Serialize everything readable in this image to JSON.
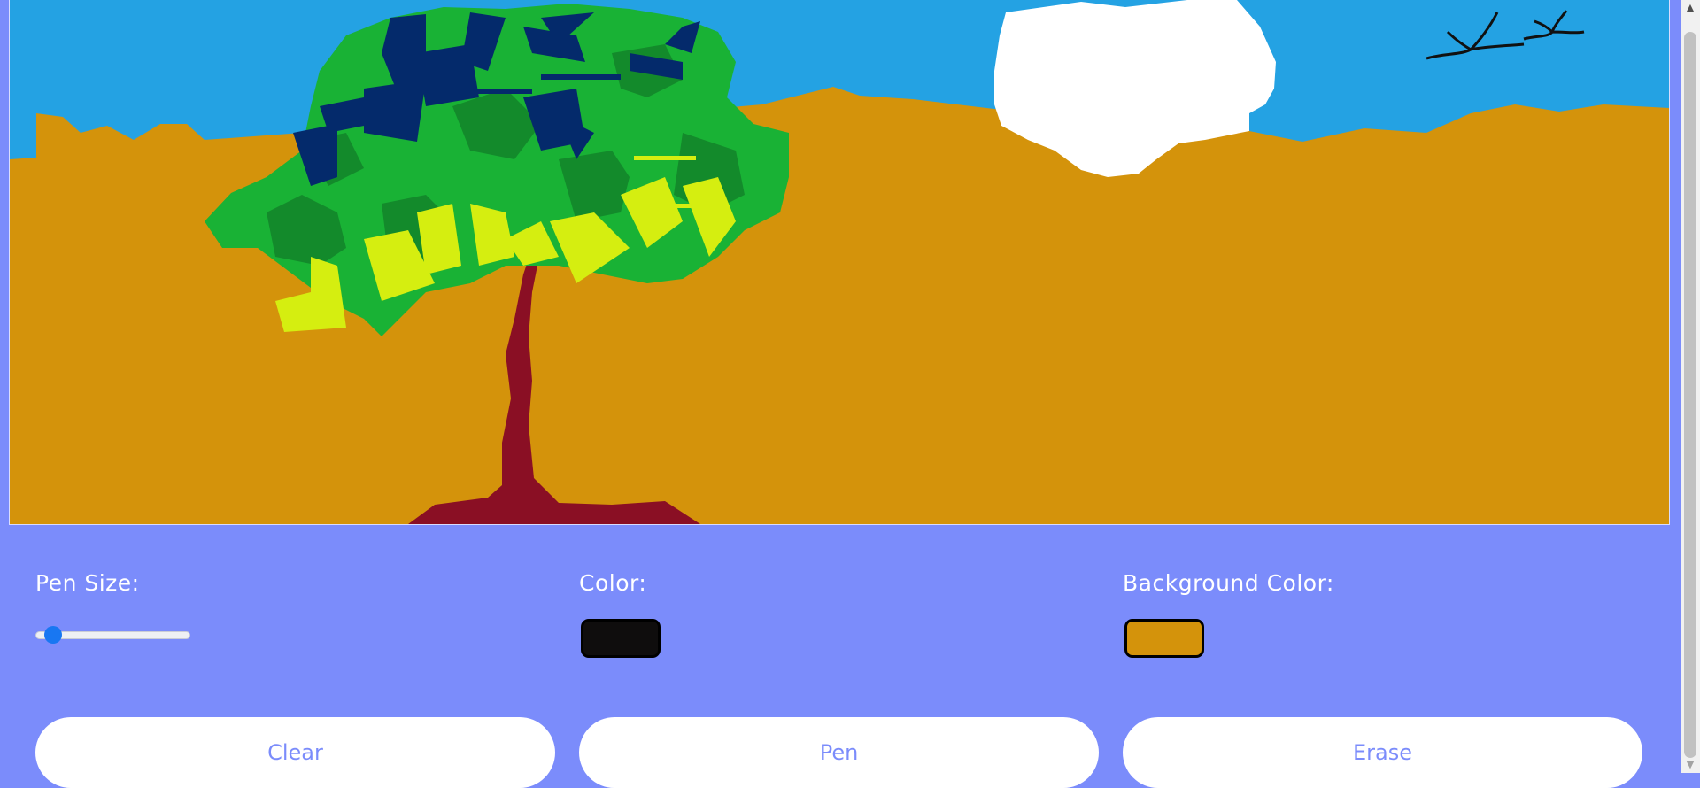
{
  "controls": {
    "pen_size_label": "Pen Size:",
    "pen_size_value_fraction": 0.05,
    "color_label": "Color:",
    "color_value": "#0f0d0d",
    "background_color_label": "Background Color:",
    "background_color_value": "#d4930b"
  },
  "buttons": {
    "clear": "Clear",
    "pen": "Pen",
    "erase": "Erase"
  },
  "colors": {
    "page_background": "#7b8cfb",
    "sky": "#24a2e3",
    "ground": "#d4930b",
    "trunk": "#8a0f24",
    "leaf_green": "#19b235",
    "leaf_dark_green": "#138a2b",
    "leaf_blue": "#042a6b",
    "leaf_yellow": "#d5ee10",
    "cloud": "#ffffff",
    "birds": "#111111"
  },
  "icons": {
    "scroll_up": "scroll-up-arrow-icon",
    "scroll_down": "scroll-down-arrow-icon"
  }
}
